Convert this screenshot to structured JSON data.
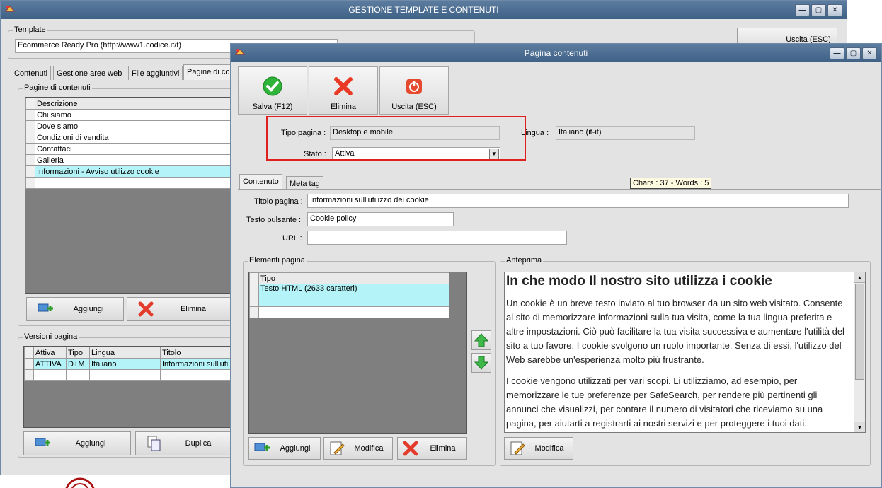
{
  "main_window": {
    "title": "GESTIONE TEMPLATE E CONTENUTI",
    "template_label": "Template",
    "template_value": "Ecommerce Ready Pro (http://www1.codice.it/t)",
    "exit_button": "Uscita (ESC)",
    "tabs": [
      "Contenuti",
      "Gestione aree web",
      "File aggiuntivi",
      "Pagine di con"
    ],
    "pages_group": "Pagine di contenuti",
    "pages_header": "Descrizione",
    "pages": [
      "Chi siamo",
      "Dove siamo",
      "Condizioni di vendita",
      "Contattaci",
      "Galleria",
      "Informazioni - Avviso utilizzo cookie"
    ],
    "add_button": "Aggiungi",
    "delete_button": "Elimina",
    "versions_group": "Versioni pagina",
    "versions_headers": [
      "Attiva",
      "Tipo",
      "Lingua",
      "Titolo"
    ],
    "versions_row": [
      "ATTIVA",
      "D+M",
      "Italiano",
      "Informazioni sull'utili"
    ],
    "add_button2": "Aggiungi",
    "duplicate_button": "Duplica"
  },
  "dialog": {
    "title": "Pagina contenuti",
    "save_button": "Salva (F12)",
    "delete_button": "Elimina",
    "exit_button": "Uscita (ESC)",
    "tipo_pagina_label": "Tipo pagina :",
    "tipo_pagina_value": "Desktop e mobile",
    "lingua_label": "Lingua :",
    "lingua_value": "Italiano (it-it)",
    "stato_label": "Stato :",
    "stato_value": "Attiva",
    "tabs": [
      "Contenuto",
      "Meta tag"
    ],
    "counter": "Chars : 37 - Words : 5",
    "titolo_label": "Titolo pagina :",
    "titolo_value": "Informazioni sull'utilizzo dei cookie",
    "testo_label": "Testo pulsante :",
    "testo_value": "Cookie policy",
    "url_label": "URL :",
    "url_value": "",
    "elements_group": "Elementi pagina",
    "elements_header": "Tipo",
    "elements_row": "Testo HTML (2633 caratteri)",
    "el_add": "Aggiungi",
    "el_edit": "Modifica",
    "el_delete": "Elimina",
    "preview_group": "Anteprima",
    "preview_title": "In che modo Il nostro sito utilizza i cookie",
    "preview_p1": "Un cookie è un breve testo inviato al tuo browser da un sito web visitato. Consente al sito di memorizzare informazioni sulla tua visita, come la tua lingua preferita e altre impostazioni. Ciò può facilitare la tua visita successiva e aumentare l'utilità del sito a tuo favore. I cookie svolgono un ruolo importante. Senza di essi, l'utilizzo del Web sarebbe un'esperienza molto più frustrante.",
    "preview_p2": "I cookie vengono utilizzati per vari scopi. Li utilizziamo, ad esempio, per memorizzare le tue preferenze per SafeSearch, per rendere più pertinenti gli annunci che visualizzi, per contare il numero di visitatori che riceviamo su una pagina, per aiutarti a registrarti ai nostri servizi e per proteggere i tuoi dati.",
    "preview_edit": "Modifica"
  },
  "colors": {
    "highlight": "#e01f1f",
    "selection": "#b4f3f7",
    "titlebar": "#4a6b90"
  }
}
